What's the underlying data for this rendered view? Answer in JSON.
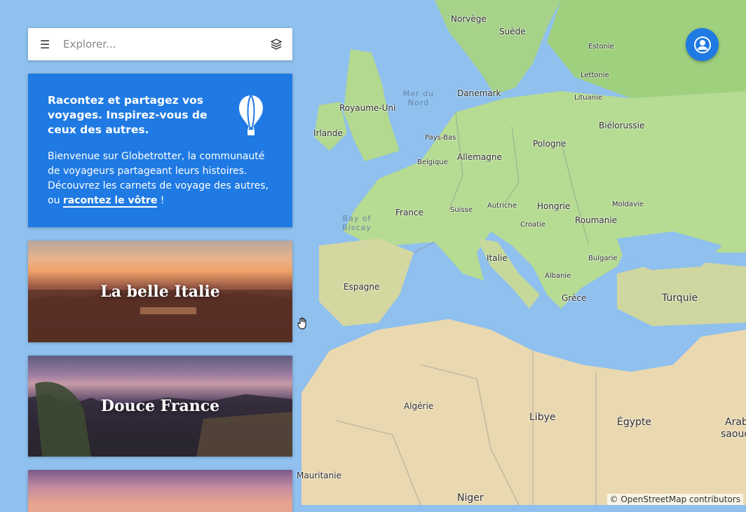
{
  "search": {
    "placeholder": "Explorer..."
  },
  "intro": {
    "title": "Racontez et partagez vos voyages. Inspirez-vous de ceux des autres.",
    "body_before": "Bienvenue sur Globetrotter, la communauté de voyageurs partageant leurs histoires. Découvrez les carnets de voyage des autres, ou ",
    "link": "racontez le vôtre",
    "body_after": " !"
  },
  "cards": [
    {
      "title": "La belle Italie"
    },
    {
      "title": "Douce France"
    },
    {
      "title": ""
    }
  ],
  "map": {
    "labels": {
      "norvege": "Norvège",
      "suede": "Suède",
      "estonie": "Estonie",
      "lettonie": "Lettonie",
      "lituanie": "Lituanie",
      "royaume_uni": "Royaume-Uni",
      "irlande": "Irlande",
      "mer_du_nord": "Mer du Nord",
      "danemark": "Danemark",
      "bielorussie": "Biélorussie",
      "pays_bas": "Pays-Bas",
      "pologne": "Pologne",
      "belgique": "Belgique",
      "allemagne": "Allemagne",
      "france": "France",
      "suisse": "Suisse",
      "autriche": "Autriche",
      "hongrie": "Hongrie",
      "moldavie": "Moldavie",
      "bay_of_biscay": "Bay of Biscay",
      "croatie": "Croatie",
      "roumanie": "Roumanie",
      "italie": "Italie",
      "bulgarie": "Bulgarie",
      "albanie": "Albanie",
      "espagne": "Espagne",
      "grece": "Grèce",
      "turquie": "Turquie",
      "algerie": "Algérie",
      "libye": "Libye",
      "egypte": "Égypte",
      "arab": "Arab",
      "saoud": "saoud",
      "mauritanie": "Mauritanie",
      "niger": "Niger"
    },
    "attribution": "© OpenStreetMap contributors"
  },
  "colors": {
    "accent": "#1f7ae3",
    "sea": "#8fc0ee",
    "land_green": "#a9d48a",
    "land_desert": "#eadbb6"
  },
  "icons": {
    "menu": "menu-icon",
    "layers": "layers-icon",
    "balloon": "hot-air-balloon-icon",
    "user": "user-icon",
    "cursor": "hand-cursor-icon"
  }
}
